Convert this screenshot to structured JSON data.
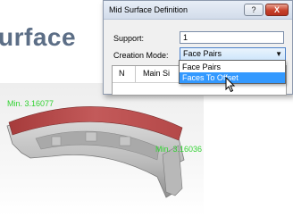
{
  "slide": {
    "heading_fragment": "urface"
  },
  "viewport": {
    "min_label_top": "Min. 3.16077",
    "min_label_right": "Min. 3.16036",
    "colors": {
      "highlight_face": "#b24a4a",
      "part_body": "#c9c9c9",
      "label_text": "#33d233"
    }
  },
  "dialog": {
    "title": "Mid Surface Definition",
    "help_button": "?",
    "close_button": "X",
    "support_label": "Support:",
    "support_value": "1",
    "creation_mode_label": "Creation Mode:",
    "creation_mode_value": "Face Pairs",
    "grid_headers": [
      "N",
      "Main Si"
    ],
    "dropdown_options": [
      "Face Pairs",
      "Faces To Offset"
    ],
    "dropdown_selected_index": 1
  }
}
